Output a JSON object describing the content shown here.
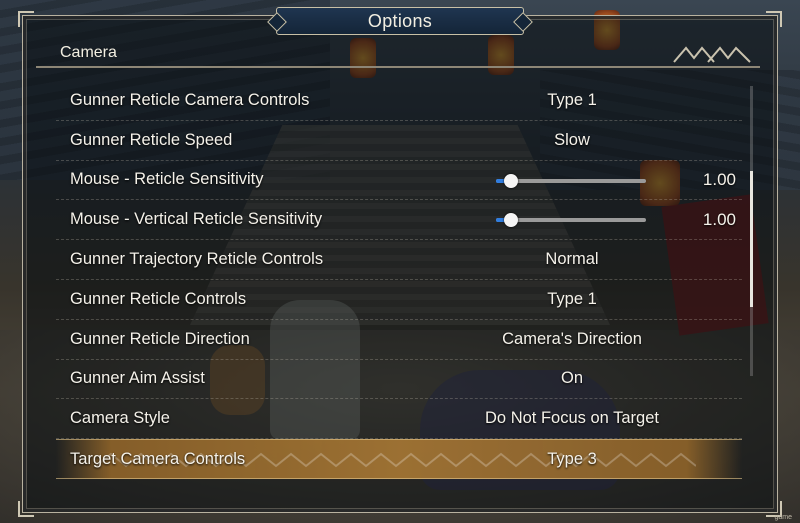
{
  "window": {
    "title": "Options"
  },
  "section": {
    "label": "Camera"
  },
  "options": [
    {
      "label": "Gunner Reticle Camera Controls",
      "value": "Type 1"
    },
    {
      "label": "Gunner Reticle Speed",
      "value": "Slow"
    },
    {
      "label": "Mouse - Reticle Sensitivity",
      "value": "1.00",
      "slider_fraction": 0.1
    },
    {
      "label": "Mouse - Vertical Reticle Sensitivity",
      "value": "1.00",
      "slider_fraction": 0.1
    },
    {
      "label": "Gunner Trajectory Reticle Controls",
      "value": "Normal"
    },
    {
      "label": "Gunner Reticle Controls",
      "value": "Type 1"
    },
    {
      "label": "Gunner Reticle Direction",
      "value": "Camera's Direction"
    },
    {
      "label": "Gunner Aim Assist",
      "value": "On"
    },
    {
      "label": "Camera Style",
      "value": "Do Not Focus on Target"
    },
    {
      "label": "Target Camera Controls",
      "value": "Type 3",
      "selected": true
    }
  ],
  "scrollbar": {
    "position_fraction": 0.55,
    "visible_fraction": 0.47
  },
  "colors": {
    "selection": "#a87834",
    "slider_fill": "#2f7de0",
    "title_plate": "#1f3550",
    "frame_border": "#b9b2a0"
  },
  "corner_tag": "game"
}
